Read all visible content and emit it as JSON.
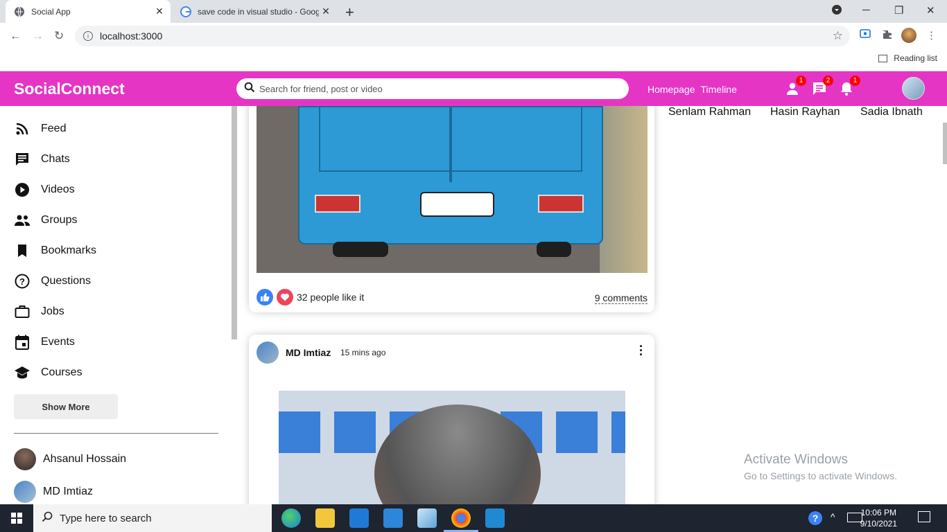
{
  "browser": {
    "tabs": [
      {
        "title": "Social App",
        "active": true
      },
      {
        "title": "save code in visual studio - Goog",
        "active": false
      }
    ],
    "url": "localhost:3000",
    "reading_list": "Reading list"
  },
  "app": {
    "logo": "SocialConnect",
    "search_placeholder": "Search for friend, post or video",
    "links": [
      "Homepage",
      "Timeline"
    ],
    "badges": {
      "person": "1",
      "chat": "2",
      "notification": "1"
    },
    "brand_color": "#e535c4"
  },
  "sidebar": {
    "items": [
      {
        "label": "Feed",
        "icon": "rss-icon"
      },
      {
        "label": "Chats",
        "icon": "chat-icon"
      },
      {
        "label": "Videos",
        "icon": "play-icon"
      },
      {
        "label": "Groups",
        "icon": "group-icon"
      },
      {
        "label": "Bookmarks",
        "icon": "bookmark-icon"
      },
      {
        "label": "Questions",
        "icon": "help-icon"
      },
      {
        "label": "Jobs",
        "icon": "briefcase-icon"
      },
      {
        "label": "Events",
        "icon": "calendar-icon"
      },
      {
        "label": "Courses",
        "icon": "school-icon"
      }
    ],
    "show_more": "Show More",
    "friends": [
      "Ahsanul Hossain",
      "MD Imtiaz"
    ]
  },
  "feed": {
    "post1": {
      "likes": "32 people like it",
      "comments": "9 comments"
    },
    "post2": {
      "author": "MD Imtiaz",
      "date": "15 mins ago"
    }
  },
  "rightbar": {
    "online_friends": [
      "Senlam Rahman",
      "Hasin Rayhan",
      "Sadia Ibnath"
    ],
    "activate_title": "Activate Windows",
    "activate_sub": "Go to Settings to activate Windows."
  },
  "taskbar": {
    "search_placeholder": "Type here to search",
    "time": "10:06 PM",
    "date": "9/10/2021"
  }
}
